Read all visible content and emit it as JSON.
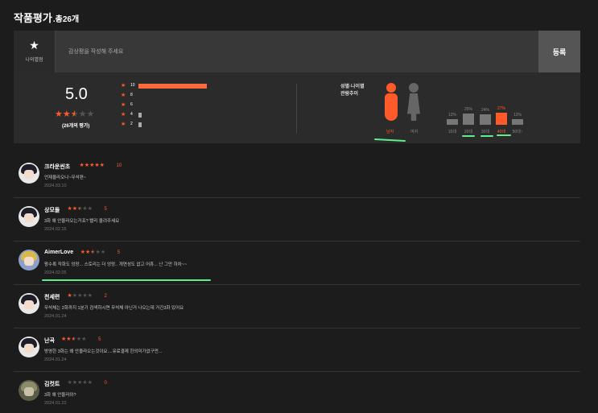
{
  "header": {
    "title": "작품평가",
    "count": ".총26개"
  },
  "write": {
    "avatar_label": "나의별점",
    "placeholder": "감상평을 작성해 주세요",
    "submit_label": "등록"
  },
  "summary": {
    "average": "5.0",
    "avg_stars": [
      "★",
      "★",
      "★",
      "★",
      "★"
    ],
    "count_label": "(26개의 평가)"
  },
  "distribution": [
    {
      "score": "10",
      "fraction": 0.92
    },
    {
      "score": "8",
      "fraction": 0.0
    },
    {
      "score": "6",
      "fraction": 0.0
    },
    {
      "score": "4",
      "fraction": 0.04
    },
    {
      "score": "2",
      "fraction": 0.04
    }
  ],
  "demographics": {
    "title_line1": "성별·나이별",
    "title_line2": "관람추이",
    "male_label": "남자",
    "female_label": "여자",
    "ages": [
      {
        "label": "10대",
        "pct": "12%",
        "value": 12,
        "active": false
      },
      {
        "label": "20대",
        "pct": "25%",
        "value": 25,
        "active": false
      },
      {
        "label": "30대",
        "pct": "24%",
        "value": 24,
        "active": false
      },
      {
        "label": "40대",
        "pct": "27%",
        "value": 27,
        "active": true
      },
      {
        "label": "50대↑",
        "pct": "12%",
        "value": 12,
        "active": false
      }
    ]
  },
  "reviews": [
    {
      "nick": "크라운씬초",
      "score": "10",
      "stars": 5,
      "text": "언제올라오나~무석편~",
      "date": "2024.03.10",
      "avatar": "dark"
    },
    {
      "nick": "상모돌",
      "score": "5",
      "stars": 2.5,
      "text": "3화 왜 안올라오는거죠? 빨리 올려주세요",
      "date": "2024.02.15",
      "avatar": "dark"
    },
    {
      "nick": "AimerLove",
      "score": "5",
      "stars": 2.5,
      "text": "왕수록 작화도 엉망... 스토리는 더 엉망.. 개연성도 없고 어휴... 난 그만 하차~~",
      "date": "2024.02.05",
      "avatar": "blonde"
    },
    {
      "nick": "천세련",
      "score": "2",
      "stars": 1,
      "text": "무석체는 2화까지 1분기 검색하시면 무석체 아닌거 나오는데 거긴3화 있어요",
      "date": "2024.01.24",
      "avatar": "dark"
    },
    {
      "nick": "난곡",
      "score": "5",
      "stars": 2.5,
      "text": "방영한 3화는 왜 안올라오는것이요....유료결제 한의미가없구먼...",
      "date": "2024.01.24",
      "avatar": "dark"
    },
    {
      "nick": "김컷트",
      "score": "0",
      "stars": 0,
      "text": "3화 왜 안올라와?",
      "date": "2024.01.22",
      "avatar": "green"
    }
  ],
  "colors": {
    "accent": "#ff5a29",
    "highlight": "#5cf08a"
  }
}
